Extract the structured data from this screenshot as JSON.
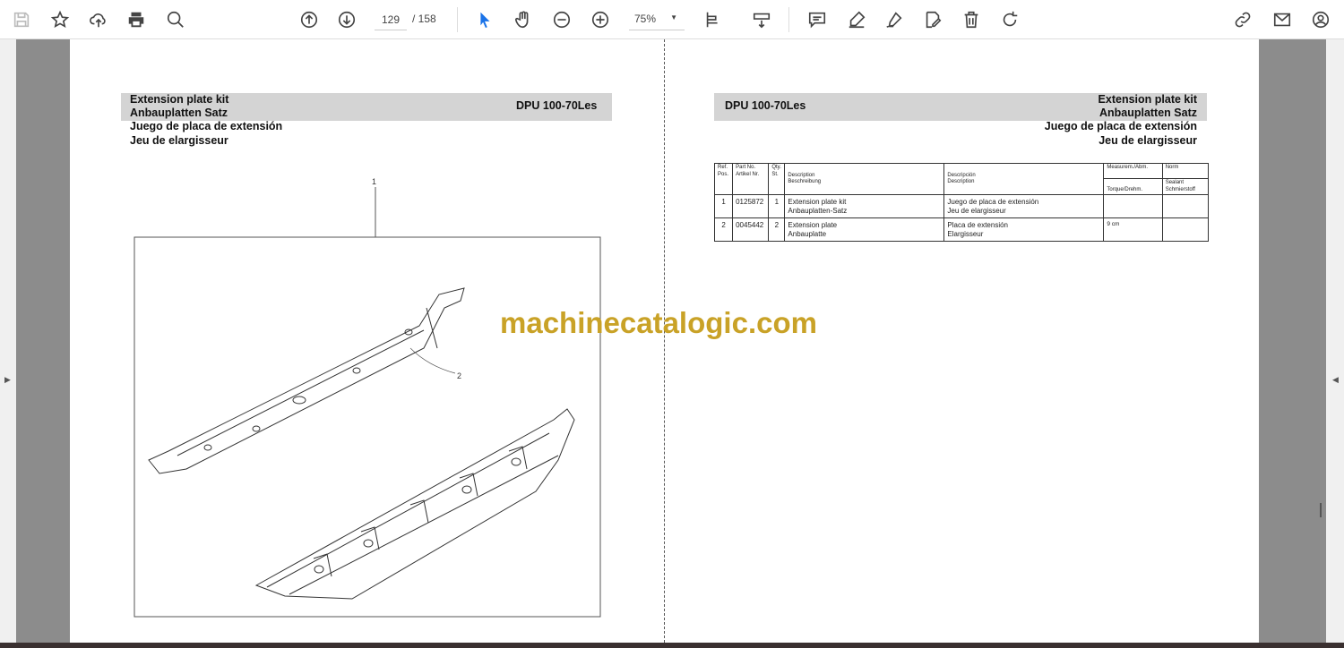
{
  "toolbar": {
    "icons": [
      "save-icon",
      "bookmark-star-icon",
      "upload-cloud-icon",
      "print-icon",
      "search-zoom-icon",
      "page-up-icon",
      "page-down-icon",
      "select-cursor-icon",
      "hand-tool-icon",
      "zoom-out-icon",
      "zoom-in-icon",
      "fit-page-icon",
      "scroll-mode-icon",
      "comment-icon",
      "highlight-icon",
      "draw-icon",
      "edit-text-icon",
      "delete-icon",
      "rotate-icon",
      "share-link-icon",
      "email-icon",
      "account-icon"
    ],
    "current_page": "129",
    "total_pages": "/ 158",
    "zoom": "75%"
  },
  "left_page": {
    "title_lines": [
      "Extension plate kit",
      "Anbauplatten Satz",
      "Juego de placa de extensión",
      "Jeu de elargisseur"
    ],
    "model": "DPU 100-70Les",
    "callouts": [
      "1",
      "2"
    ]
  },
  "right_page": {
    "model": "DPU 100-70Les",
    "title_lines": [
      "Extension plate kit",
      "Anbauplatten Satz",
      "Juego de placa de extensión",
      "Jeu de elargisseur"
    ],
    "table": {
      "headers": {
        "ref": [
          "Ref.",
          "Pos."
        ],
        "part": [
          "Part No.",
          "Artikel Nr."
        ],
        "qty": [
          "Qty.",
          "St."
        ],
        "desc1": [
          "Description",
          "Beschreibung"
        ],
        "desc2": [
          "Descripción",
          "Description"
        ],
        "meas": "Measurem./Abm.",
        "torque": "Torque/Drehm.",
        "norm": "Norm",
        "sealant": [
          "Sealant",
          "Schmierstoff"
        ]
      },
      "rows": [
        {
          "ref": "1",
          "part": "0125872",
          "qty": "1",
          "desc1": [
            "Extension plate kit",
            "Anbauplatten-Satz"
          ],
          "desc2": [
            "Juego de placa de extensión",
            "Jeu de elargisseur"
          ],
          "meas": "",
          "norm": ""
        },
        {
          "ref": "2",
          "part": "0045442",
          "qty": "2",
          "desc1": [
            "Extension plate",
            "Anbauplatte"
          ],
          "desc2": [
            "Placa de extensión",
            "Elargisseur"
          ],
          "meas": "9 cm",
          "norm": ""
        }
      ]
    }
  },
  "watermark": "machinecatalogic.com",
  "colors": {
    "header_bg": "#d4d4d4",
    "watermark": "#c9a227",
    "select_blue": "#1a73e8"
  }
}
